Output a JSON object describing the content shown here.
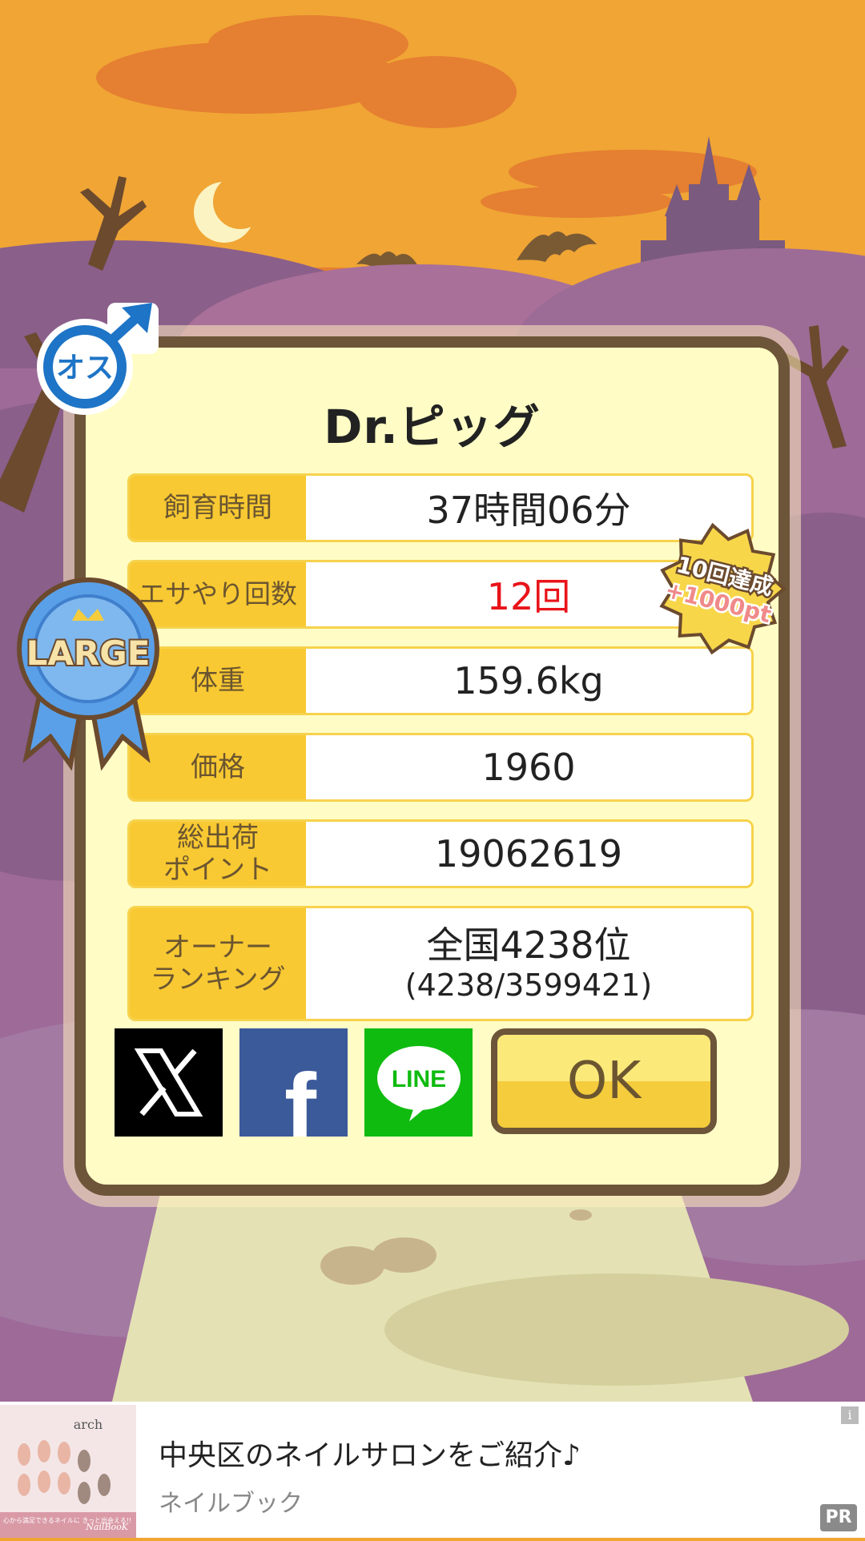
{
  "pig": {
    "name": "Dr.ピッグ",
    "gender_label": "オス",
    "size_badge": "LARGE"
  },
  "stats": [
    {
      "label": "飼育時間",
      "value": "37時間06分"
    },
    {
      "label": "エサやり回数",
      "value": "12回"
    },
    {
      "label": "体重",
      "value": "159.6kg"
    },
    {
      "label": "価格",
      "value": "1960"
    },
    {
      "label": "総出荷\nポイント",
      "value": "19062619"
    },
    {
      "label": "オーナー\nランキング",
      "value": "全国4238位",
      "value_sub": "(4238/3599421)"
    }
  ],
  "achievement": {
    "line1": "10回達成",
    "line2": "+1000pt"
  },
  "share": {
    "x": "X",
    "facebook": "f",
    "line": "LINE"
  },
  "ok_label": "OK",
  "ad": {
    "title": "中央区のネイルサロンをご紹介♪",
    "advertiser": "ネイルブック",
    "thumb_brand": "arch",
    "thumb_caption": "心から満足できるネイルに\nきっと出会える!!",
    "thumb_logo": "NailBooK",
    "pr": "PR",
    "info": "i"
  },
  "colors": {
    "sky": "#f0a535",
    "card_bg": "#fffdc5",
    "card_border": "#6d5539",
    "label_bg": "#f8c932",
    "highlight_red": "#e8141a",
    "gender_blue": "#1e74c6"
  }
}
